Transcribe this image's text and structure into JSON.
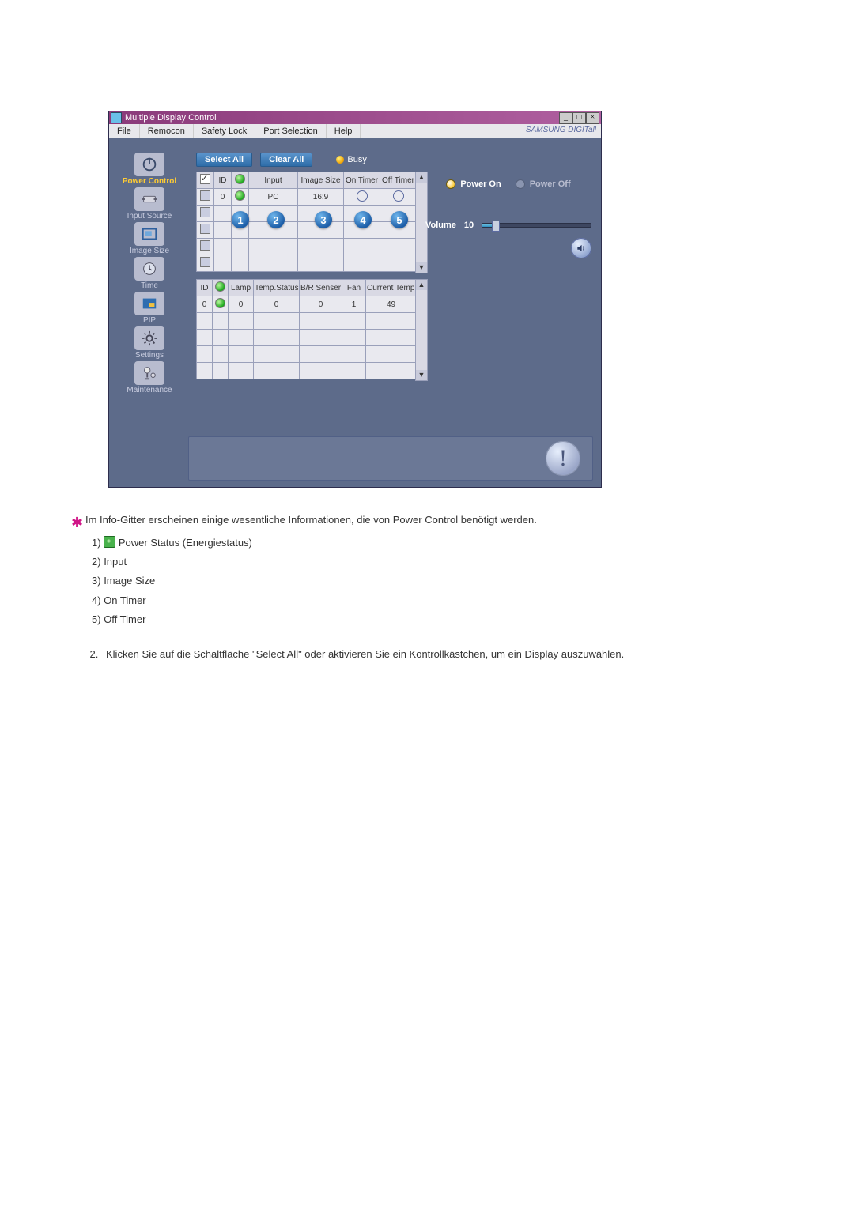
{
  "window": {
    "title": "Multiple Display Control",
    "brand": "SAMSUNG DIGITall"
  },
  "menu": [
    "File",
    "Remocon",
    "Safety Lock",
    "Port Selection",
    "Help"
  ],
  "sidebar": [
    {
      "label": "Power Control",
      "active": true
    },
    {
      "label": "Input Source"
    },
    {
      "label": "Image Size"
    },
    {
      "label": "Time"
    },
    {
      "label": "PIP"
    },
    {
      "label": "Settings"
    },
    {
      "label": "Maintenance"
    }
  ],
  "buttons": {
    "select_all": "Select All",
    "clear_all": "Clear All",
    "busy": "Busy"
  },
  "grid1": {
    "headers": [
      "",
      "ID",
      "",
      "Input",
      "Image Size",
      "On Timer",
      "Off Timer"
    ],
    "status_icon_title": "Power-Status",
    "rows": [
      {
        "checked": false,
        "id": "0",
        "status": "green",
        "input": "PC",
        "image_size": "16:9",
        "on_timer": "o",
        "off_timer": "o"
      },
      {
        "checked": false,
        "id": "",
        "status": "",
        "input": "",
        "image_size": "",
        "on_timer": "",
        "off_timer": ""
      },
      {
        "checked": false,
        "id": "",
        "status": "",
        "input": "",
        "image_size": "",
        "on_timer": "",
        "off_timer": ""
      },
      {
        "checked": false,
        "id": "",
        "status": "",
        "input": "",
        "image_size": "",
        "on_timer": "",
        "off_timer": ""
      },
      {
        "checked": false,
        "id": "",
        "status": "",
        "input": "",
        "image_size": "",
        "on_timer": "",
        "off_timer": ""
      }
    ]
  },
  "callouts": [
    "1",
    "2",
    "3",
    "4",
    "5"
  ],
  "grid2": {
    "headers": [
      "ID",
      "",
      "Lamp",
      "Temp.Status",
      "B/R Senser",
      "Fan",
      "Current Temp."
    ],
    "rows": [
      {
        "id": "0",
        "status": "green",
        "lamp": "0",
        "temp_status": "0",
        "br": "0",
        "fan": "1",
        "cur_temp": "49"
      },
      {
        "id": "",
        "status": "",
        "lamp": "",
        "temp_status": "",
        "br": "",
        "fan": "",
        "cur_temp": ""
      },
      {
        "id": "",
        "status": "",
        "lamp": "",
        "temp_status": "",
        "br": "",
        "fan": "",
        "cur_temp": ""
      },
      {
        "id": "",
        "status": "",
        "lamp": "",
        "temp_status": "",
        "br": "",
        "fan": "",
        "cur_temp": ""
      },
      {
        "id": "",
        "status": "",
        "lamp": "",
        "temp_status": "",
        "br": "",
        "fan": "",
        "cur_temp": ""
      }
    ]
  },
  "right": {
    "power_on": "Power On",
    "power_off": "Power Off",
    "volume_label": "Volume",
    "volume_value": "10"
  },
  "doc": {
    "intro": "Im Info-Gitter erscheinen einige wesentliche Informationen, die von Power Control benötigt werden.",
    "legend": [
      "Power Status (Energiestatus)",
      "Input",
      "Image Size",
      "On Timer",
      "Off Timer"
    ],
    "legend_nums": [
      "1)",
      "2)",
      "3)",
      "4)",
      "5)"
    ],
    "step2": "Klicken Sie auf die Schaltfläche \"Select All\" oder aktivieren Sie ein Kontrollkästchen, um ein Display auszuwählen."
  }
}
